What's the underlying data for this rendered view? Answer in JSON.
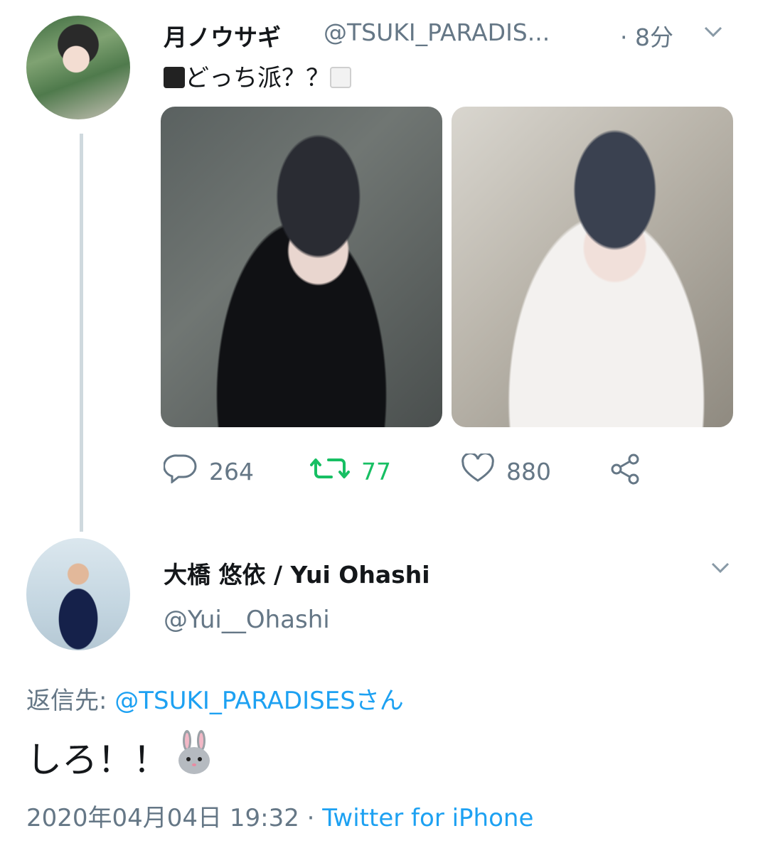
{
  "tweet1": {
    "display_name": "月ノウサギ",
    "handle": "@TSUKI_PARADIS...",
    "time": "· 8分",
    "text": "どっち派？？",
    "leading_emoji": "black-large-square",
    "trailing_emoji": "white-large-square",
    "actions": {
      "reply_count": "264",
      "retweet_count": "77",
      "like_count": "880"
    },
    "retweet_color": "#17bf63"
  },
  "tweet2": {
    "display_name": "大橋 悠依 / Yui Ohashi",
    "handle": "@Yui__Ohashi",
    "replying_label": "返信先:",
    "replying_to": "@TSUKI_PARADISESさん",
    "text": "しろ！！",
    "emoji": "rabbit-face",
    "timestamp": "2020年04月04日 19:32 ·",
    "source": "Twitter for iPhone"
  },
  "colors": {
    "link": "#1da1f2",
    "secondary": "#657786",
    "thread_line": "#cfd9de"
  },
  "icons": [
    "reply-icon",
    "retweet-icon",
    "like-icon",
    "share-icon",
    "chevron-down-icon"
  ]
}
